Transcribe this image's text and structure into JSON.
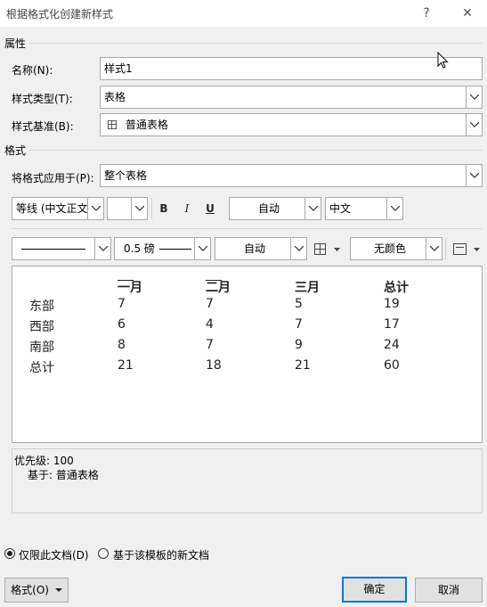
{
  "window": {
    "title": "根据格式化创建新样式",
    "help_glyph": "?",
    "close_glyph": "✕"
  },
  "properties": {
    "section_label": "属性",
    "name_label": "名称(N):",
    "name_value": "样式1",
    "type_label": "样式类型(T):",
    "type_value": "表格",
    "based_on_label": "样式基准(B):",
    "based_on_value": "普通表格"
  },
  "format": {
    "section_label": "格式",
    "apply_to_label": "将格式应用于(P):",
    "apply_to_value": "整个表格",
    "font_value": "等线 (中文正文",
    "font_size_value": "",
    "bold": "B",
    "italic": "I",
    "underline": "U",
    "font_color_value": "自动",
    "language_value": "中文",
    "border_style_value": "",
    "border_width_value": "0.5 磅",
    "border_color_value": "自动",
    "shading_value": "无颜色"
  },
  "preview_table": {
    "columns": [
      "",
      "一月",
      "二月",
      "三月",
      "总计"
    ],
    "rows": [
      [
        "东部",
        "7",
        "7",
        "5",
        "19"
      ],
      [
        "西部",
        "6",
        "4",
        "7",
        "17"
      ],
      [
        "南部",
        "8",
        "7",
        "9",
        "24"
      ],
      [
        "总计",
        "21",
        "18",
        "21",
        "60"
      ]
    ]
  },
  "description": {
    "line1": "优先级: 100",
    "line2": "基于: 普通表格"
  },
  "options": {
    "only_this_doc": "仅限此文档(D)",
    "new_docs_template": "基于该模板的新文档"
  },
  "buttons": {
    "format_label": "格式(O)",
    "ok_label": "确定",
    "cancel_label": "取消"
  }
}
